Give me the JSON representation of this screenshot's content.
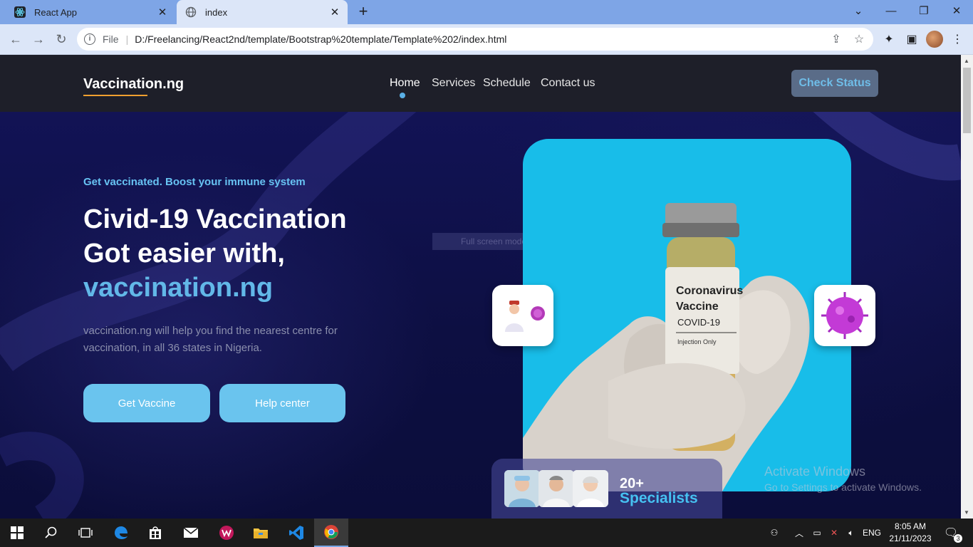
{
  "browser": {
    "tabs": [
      {
        "title": "React App",
        "active": false,
        "icon": "react-icon"
      },
      {
        "title": "index",
        "active": true,
        "icon": "globe-icon"
      }
    ],
    "new_tab_label": "+",
    "address": {
      "scheme_label": "File",
      "url": "D:/Freelancing/React2nd/template/Bootstrap%20template/Template%202/index.html"
    }
  },
  "site": {
    "brand": "Vaccination.ng",
    "nav": [
      "Home",
      "Services",
      "Schedule",
      "Contact us"
    ],
    "active_nav": "Home",
    "check_status": "Check Status",
    "hero": {
      "eyebrow": "Get vaccinated. Boost your immune system",
      "title_line1": "Civid-19 Vaccination",
      "title_line2": "Got easier with,",
      "title_line3": "vaccination.ng",
      "lead": "vaccination.ng will help you find the nearest centre for vaccination, in all 36 states in Nigeria.",
      "btn_primary": "Get Vaccine",
      "btn_secondary": "Help center"
    },
    "tooltip_ghost": "Full screen mode",
    "vial": {
      "line1": "Coronavirus",
      "line2": "Vaccine",
      "line3": "COVID-19",
      "line4": "Injection Only"
    },
    "specialists": {
      "count": "20+",
      "label": "Specialists"
    }
  },
  "watermark": {
    "line1": "Activate Windows",
    "line2": "Go to Settings to activate Windows."
  },
  "taskbar": {
    "language": "ENG",
    "time": "8:05 AM",
    "date": "21/11/2023",
    "notifications": "3"
  },
  "colors": {
    "accent": "#62b8e8",
    "page_bg": "#0f1246",
    "hero_card": "#18bde9",
    "brand_underline": "#f0a030"
  }
}
